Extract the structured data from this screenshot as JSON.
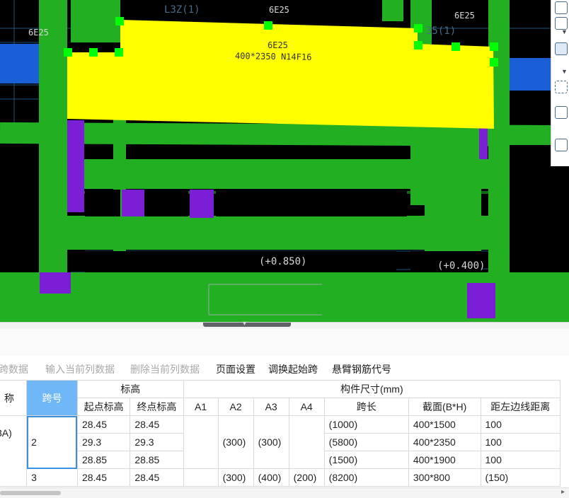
{
  "canvas": {
    "beam_label_line1": "6E25",
    "beam_label_line2": "400*2350 N14F16",
    "top_label_left": "6E25",
    "top_label_mid": "6E25",
    "top_label_right": "6E25",
    "top_mark": "L3Z(1)",
    "right_mark": "35(1)",
    "mid_elev_left": "(+0.850)",
    "mid_elev_right": "(+0.400)",
    "bg_color": "#000000",
    "beam_color": "#ffff00",
    "member_color": "#22b022",
    "column_color": "#7a1fd6",
    "grip_color": "#00ff00"
  },
  "toolbar": {
    "items": [
      {
        "label": "跨数据",
        "enabled": false
      },
      {
        "label": "输入当前列数据",
        "enabled": false
      },
      {
        "label": "删除当前列数据",
        "enabled": false
      },
      {
        "label": "页面设置",
        "enabled": true
      },
      {
        "label": "调换起始跨",
        "enabled": true
      },
      {
        "label": "悬臂钢筋代号",
        "enabled": true
      }
    ]
  },
  "table": {
    "headers": {
      "name": "称",
      "span_no": "跨号",
      "elevation": "标高",
      "start_elev": "起点标高",
      "end_elev": "终点标高",
      "a1": "A1",
      "a2": "A2",
      "a3": "A3",
      "a4": "A4",
      "dims": "构件尺寸(mm)",
      "span_len": "跨长",
      "section": "截面(B*H)",
      "left_dist": "距左边线距离"
    },
    "name_value": "3A)",
    "span2": "2",
    "span3": "3",
    "span2_a2": "(300)",
    "span2_a3": "(300)",
    "rows": [
      {
        "start": "28.45",
        "end": "28.45",
        "span_len": "(1000)",
        "section": "400*1500",
        "left_dist": "100"
      },
      {
        "start": "29.3",
        "end": "29.3",
        "span_len": "(5800)",
        "section": "400*2350",
        "left_dist": "100"
      },
      {
        "start": "28.85",
        "end": "28.85",
        "span_len": "(1500)",
        "section": "400*1900",
        "left_dist": "100"
      }
    ],
    "row3": {
      "start": "28.45",
      "end": "28.45",
      "a2": "(300)",
      "a3": "(400)",
      "a4": "(200)",
      "span_len": "(8200)",
      "section": "300*800",
      "left_dist": "(150)"
    }
  }
}
